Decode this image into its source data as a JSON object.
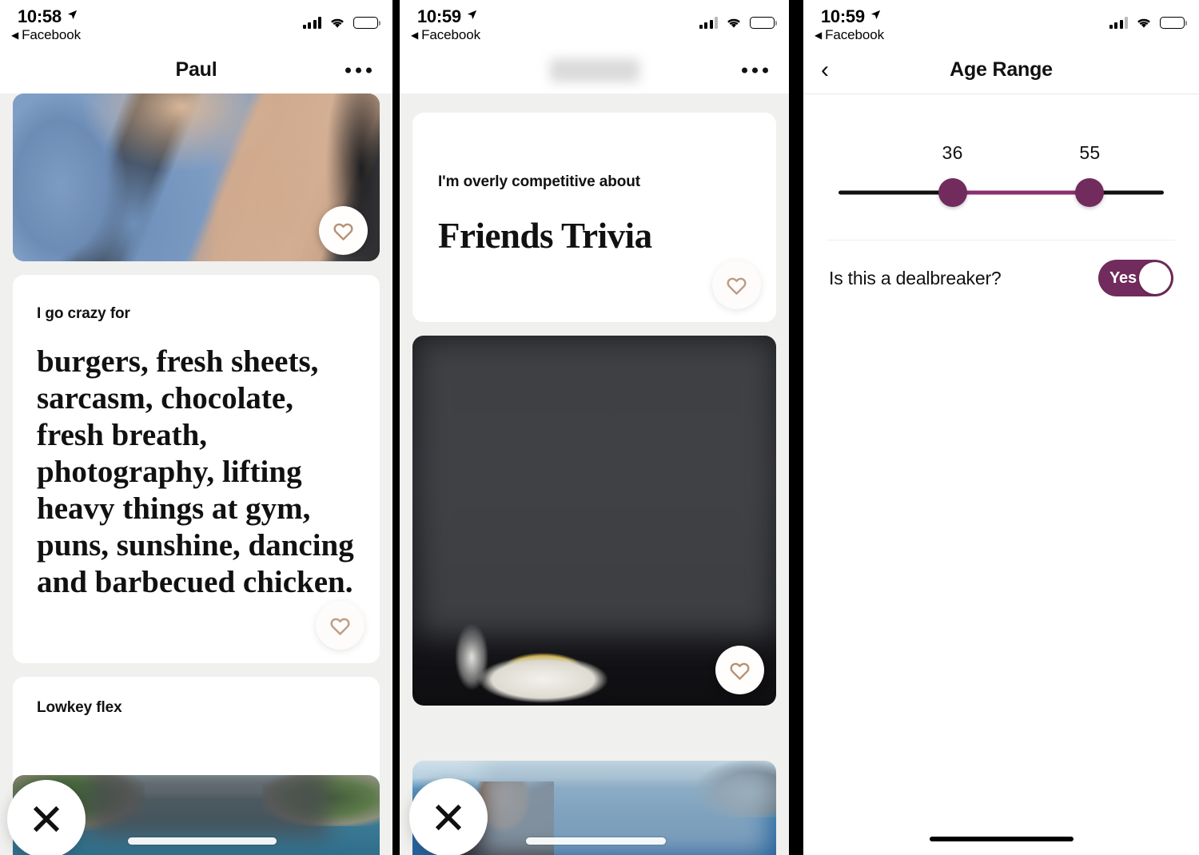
{
  "meta": {
    "accent_purple": "#712B5C",
    "heart_color": "#b99274",
    "card_bg": "#ffffff",
    "feed_bg": "#f0f0ef"
  },
  "panels": [
    {
      "id": "profile-paul",
      "status_bar": {
        "time": "10:58",
        "back_app": "Facebook",
        "location_icon": "location-arrow-icon",
        "signal_icon": "cellular-signal-icon",
        "wifi_icon": "wifi-icon",
        "battery_icon": "battery-icon"
      },
      "nav": {
        "title": "Paul",
        "more_icon": "more-options-icon"
      },
      "cards": [
        {
          "type": "photo",
          "name": "profile-photo-gym",
          "like_icon": "heart-icon"
        },
        {
          "type": "prompt",
          "name": "prompt-card-go-crazy-for",
          "eyebrow": "I go crazy for",
          "answer": "burgers, fresh sheets, sarcasm, chocolate, fresh breath, photography, lifting heavy things at gym, puns, sunshine, dancing and barbecued chicken.",
          "like_icon": "heart-icon"
        },
        {
          "type": "prompt",
          "name": "prompt-card-lowkey-flex",
          "eyebrow": "Lowkey flex",
          "answer": "",
          "like_icon": "heart-icon"
        }
      ],
      "dislike_button": {
        "label": "X",
        "icon": "close-x-icon"
      }
    },
    {
      "id": "profile-redacted",
      "status_bar": {
        "time": "10:59",
        "back_app": "Facebook",
        "location_icon": "location-arrow-icon",
        "signal_icon": "cellular-signal-icon",
        "wifi_icon": "wifi-icon",
        "battery_icon": "battery-icon"
      },
      "nav": {
        "title": "",
        "title_redacted": true,
        "more_icon": "more-options-icon"
      },
      "cards": [
        {
          "type": "prompt",
          "name": "prompt-card-overly-competitive",
          "eyebrow": "I'm overly competitive about",
          "answer": "Friends Trivia",
          "like_icon": "heart-icon"
        },
        {
          "type": "photo",
          "name": "profile-photo-dinner",
          "like_icon": "heart-icon"
        },
        {
          "type": "photo",
          "name": "profile-photo-sea",
          "like_icon": "heart-icon"
        }
      ],
      "dislike_button": {
        "label": "X",
        "icon": "close-x-icon"
      }
    },
    {
      "id": "age-range-settings",
      "status_bar": {
        "time": "10:59",
        "back_app": "Facebook",
        "location_icon": "location-arrow-icon",
        "signal_icon": "cellular-signal-icon",
        "wifi_icon": "wifi-icon",
        "battery_icon": "battery-icon"
      },
      "nav": {
        "title": "Age Range",
        "back_icon": "chevron-left-icon"
      },
      "age_range": {
        "min_value": "36",
        "max_value": "55",
        "min_percent": 36,
        "max_percent": 72,
        "track_color": "#101010",
        "active_color": "#8C2E72",
        "knob_color": "#712B5C"
      },
      "dealbreaker": {
        "label": "Is this a dealbreaker?",
        "toggle_value": "Yes",
        "toggle_on": true,
        "toggle_color": "#712B5C"
      },
      "home_indicator": "home-indicator"
    }
  ]
}
